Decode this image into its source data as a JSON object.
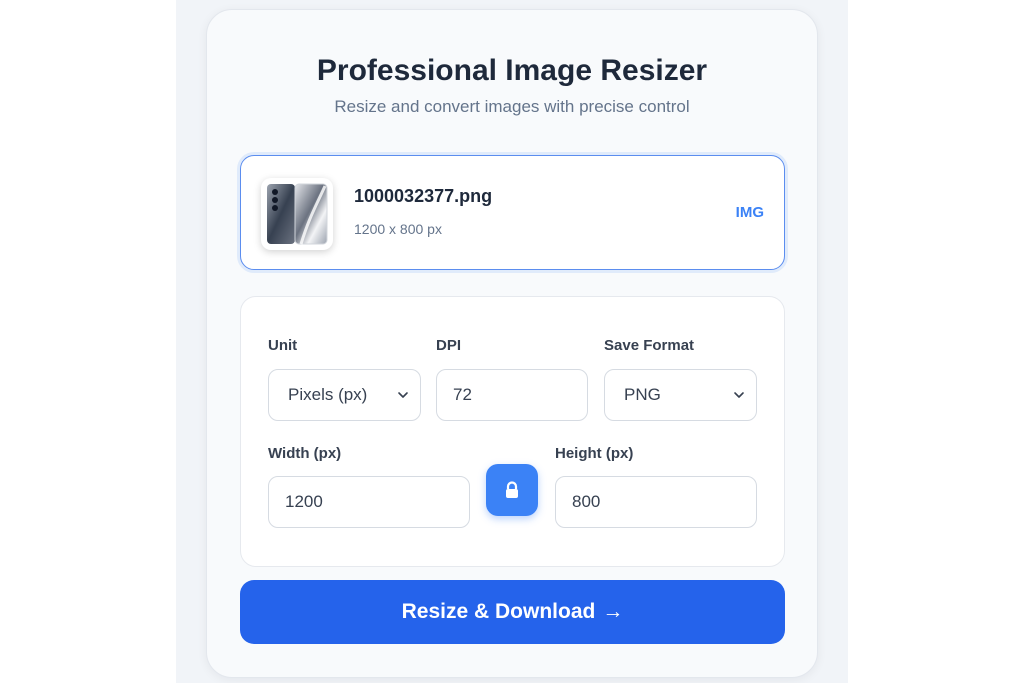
{
  "header": {
    "title": "Professional Image Resizer",
    "subtitle": "Resize and convert images with precise control"
  },
  "file": {
    "name": "1000032377.png",
    "dimensions": "1200 x 800 px",
    "type_badge": "IMG",
    "thumbnail_icon": "phone-product-thumbnail"
  },
  "settings": {
    "unit": {
      "label": "Unit",
      "value": "Pixels (px)"
    },
    "dpi": {
      "label": "DPI",
      "value": "72"
    },
    "format": {
      "label": "Save Format",
      "value": "PNG"
    },
    "width": {
      "label": "Width (px)",
      "value": "1200"
    },
    "height": {
      "label": "Height (px)",
      "value": "800"
    },
    "lock_icon": "lock-icon"
  },
  "actions": {
    "resize_download": "Resize & Download",
    "arrow": "→"
  },
  "colors": {
    "accent": "#3b82f6",
    "primary_button": "#2563eb",
    "title_text": "#1e293b",
    "muted_text": "#64748b"
  }
}
